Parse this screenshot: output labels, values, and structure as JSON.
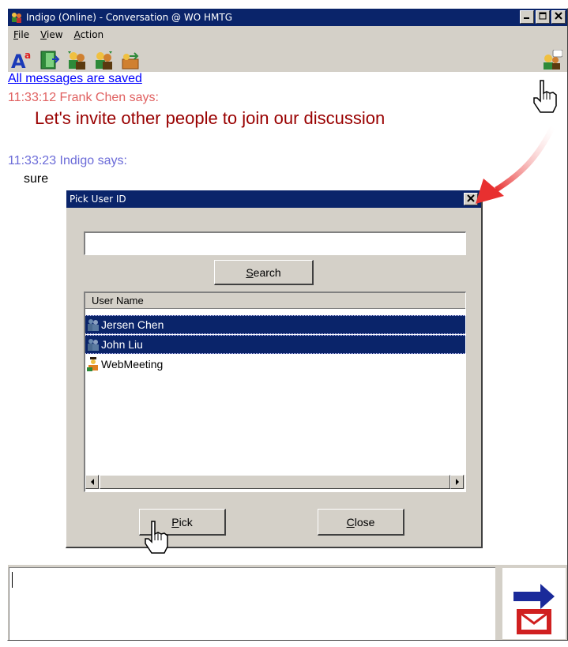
{
  "window": {
    "title": "Indigo (Online) - Conversation @ WO HMTG",
    "buttons": {
      "minimize": "_",
      "maximize": "□",
      "close": "×"
    }
  },
  "menu": {
    "file": {
      "key": "F",
      "rest": "ile"
    },
    "view": {
      "key": "V",
      "rest": "iew"
    },
    "action": {
      "key": "A",
      "rest": "ction"
    }
  },
  "toolbar": {
    "font_icon_text": "A",
    "font_icon_sup": "a"
  },
  "transcript": {
    "saved_notice": "All messages are saved",
    "messages": [
      {
        "header": "11:33:12 Frank Chen says:",
        "body": "Let's invite other people to join our discussion",
        "header_color": "#e06060",
        "body_color": "#990000"
      },
      {
        "header": "11:33:23 Indigo says:",
        "body": "sure",
        "header_color": "#6b6bd8",
        "body_color": "#000000"
      }
    ]
  },
  "dialog": {
    "title": "Pick User ID",
    "close_label": "×",
    "search_value": "",
    "search_button": {
      "key": "S",
      "rest": "earch"
    },
    "list_header": "User Name",
    "users": [
      {
        "name": "Jersen Chen",
        "selected": true,
        "icon": "user-group-icon"
      },
      {
        "name": "John Liu",
        "selected": true,
        "icon": "user-group-icon"
      },
      {
        "name": "WebMeeting",
        "selected": false,
        "icon": "meeting-user-icon"
      }
    ],
    "pick_button": {
      "key": "P",
      "rest": "ick"
    },
    "close_button": {
      "key": "C",
      "rest": "lose"
    }
  },
  "colors": {
    "titlebar": "#0a246a",
    "face": "#d4d0c8",
    "selection": "#0a246a",
    "link": "#0000ff",
    "annotation_arrow": "#e83030"
  }
}
